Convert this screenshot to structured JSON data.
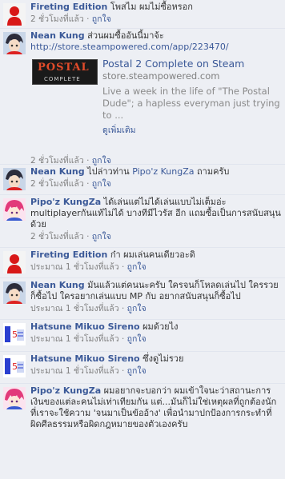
{
  "colors": {
    "link": "#3b5998",
    "meta": "#808080",
    "background": "#edeff4"
  },
  "comments": [
    {
      "author": "Fireting Edition",
      "text": "โพสไม ผมไม่ซื้อหรอก",
      "time": "2 ชั่วโมงที่แล้ว",
      "like": "ถูกใจ",
      "avatar": "red-silhouette-avatar"
    },
    {
      "author": "Nean Kung",
      "text": "ส่วนผมซื้ออันนี้มาจ้ะ",
      "link": "http://store.steampowered.com/app/223470/",
      "attachment": {
        "thumb_title": "POSTAL",
        "thumb_sub": "COMPLETE",
        "title": "Postal 2 Complete on Steam",
        "domain": "store.steampowered.com",
        "description": "Live a week in the life of \"The Postal Dude\"; a hapless everyman just trying to ...",
        "more": "ดูเพิ่มเติม"
      },
      "time": "2 ชั่วโมงที่แล้ว",
      "like": "ถูกใจ",
      "avatar": "anime-boy-avatar"
    },
    {
      "author": "Nean Kung",
      "text_prefix": "ไปล่าวท่าน",
      "mention": "Pipo'z KungZa",
      "text_suffix": "ถามครับ",
      "time": "2 ชั่วโมงที่แล้ว",
      "like": "ถูกใจ",
      "avatar": "anime-boy-avatar"
    },
    {
      "author": "Pipo'z KungZa",
      "text": "ได้เล่นแต่ไม่ได้เล่นแบบไม่เต็มอ่ะ multiplayerกันแท้ไม่ได้ บางทีมีไวรัส อีก แถมซื้อเป็นการสนับสนุนด้วย",
      "time": "2 ชั่วโมงที่แล้ว",
      "like": "ถูกใจ",
      "avatar": "anime-pink-avatar"
    },
    {
      "author": "Fireting Edition",
      "text": "ก๋า ผมเล่นคนเดียวอะดิ",
      "time": "ประมาณ 1 ชั่วโมงที่แล้ว",
      "like": "ถูกใจ",
      "avatar": "red-silhouette-avatar"
    },
    {
      "author": "Nean Kung",
      "text": "มันแล้วแต่คนนะครับ ใครจนก็โหลดเล่นไป ใครรวยก็ซื้อไป ใครอยากเล่นแบบ MP กับ อยากสนับสนุนก็ซื้อไป",
      "time": "ประมาณ 1 ชั่วโมงที่แล้ว",
      "like": "ถูกใจ",
      "avatar": "anime-boy-avatar"
    },
    {
      "author": "Hatsune Mikuo Sireno",
      "text": "ผมด้วยไง",
      "time": "ประมาณ 1 ชั่วโมงที่แล้ว",
      "like": "ถูกใจ",
      "avatar": "sticker-avatar"
    },
    {
      "author": "Hatsune Mikuo Sireno",
      "text": "ซึ่งดูไม่รวย",
      "time": "ประมาณ 1 ชั่วโมงที่แล้ว",
      "like": "ถูกใจ",
      "avatar": "sticker-avatar"
    },
    {
      "author": "Pipo'z KungZa",
      "text": "ผมอยากจะบอกว่า ผมเข้าใจนะว่าสถานะการเงินของแต่ละคนไม่เท่าเทียมกัน แต่...มันก็ไม่ใช่เหตุผลที่ถูกต้องนัก ที่เราจะใช้ความ 'จนมาเป็นข้ออ้าง' เพื่อนำมาปกป้องการกระทำที่ผิดศีลธรรมหรือผิดกฎหมายของตัวเองครับ",
      "avatar": "anime-pink-avatar"
    }
  ]
}
